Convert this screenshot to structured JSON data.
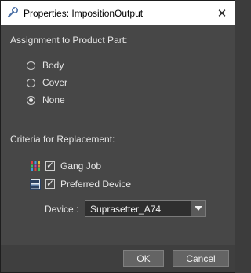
{
  "window": {
    "title": "Properties: ImpositionOutput",
    "close_glyph": "✕",
    "icon": "wrench-icon"
  },
  "assignment": {
    "label": "Assignment to Product Part:",
    "options": [
      {
        "label": "Body",
        "checked": false
      },
      {
        "label": "Cover",
        "checked": false
      },
      {
        "label": "None",
        "checked": true
      }
    ]
  },
  "criteria": {
    "label": "Criteria for Replacement:",
    "items": [
      {
        "label": "Gang Job",
        "checked": true,
        "icon": "gang-job-icon"
      },
      {
        "label": "Preferred Device",
        "checked": true,
        "icon": "device-icon"
      }
    ]
  },
  "device": {
    "label": "Device :",
    "value": "Suprasetter_A74"
  },
  "buttons": {
    "ok": "OK",
    "cancel": "Cancel"
  },
  "colors": {
    "background": "#474747",
    "titlebar": "#ffffff",
    "text": "#e6e6e6",
    "button": "#646464"
  }
}
